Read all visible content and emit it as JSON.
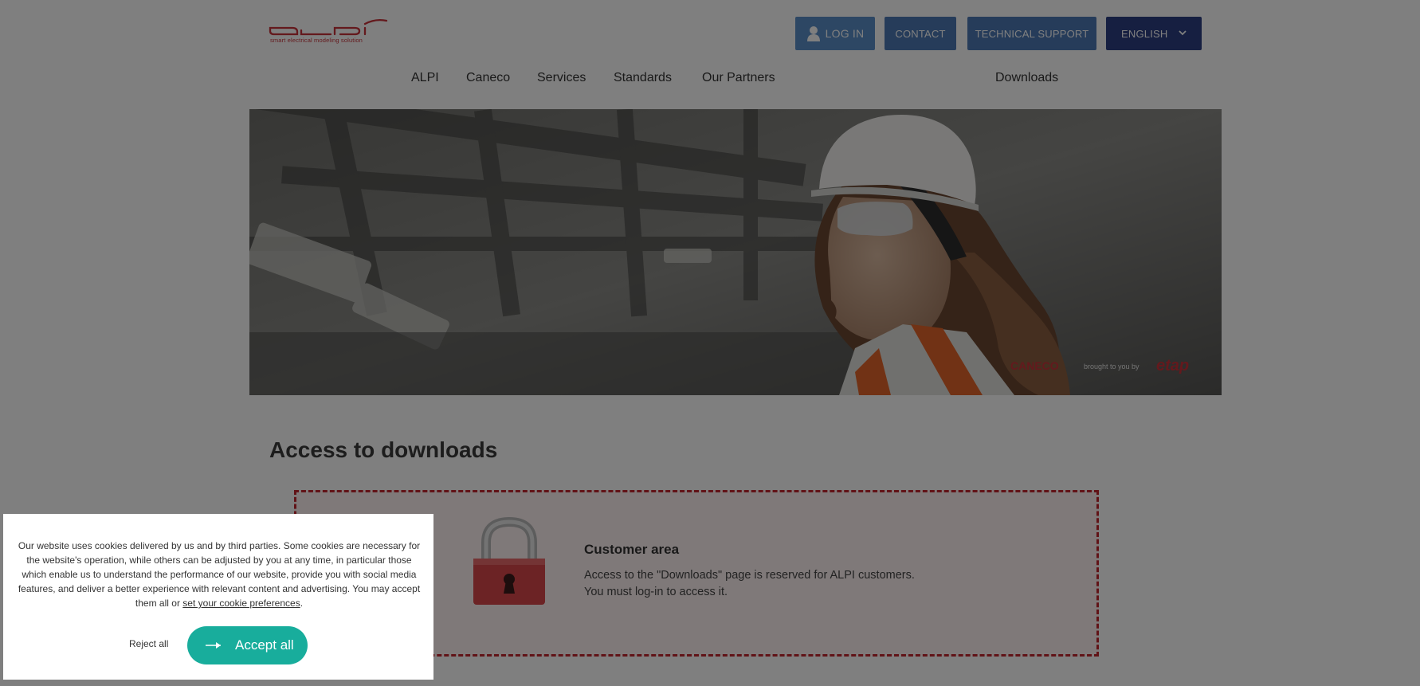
{
  "brand": {
    "logo_text": "ALPI",
    "tagline": "smart electrical modeling solution",
    "brand_color": "#c8333a"
  },
  "header": {
    "login_label": "LOG IN",
    "contact_label": "CONTACT",
    "support_label": "TECHNICAL SUPPORT",
    "language_label": "ENGLISH"
  },
  "nav": {
    "items": [
      "ALPI",
      "Caneco",
      "Services",
      "Standards",
      "Our Partners",
      "Downloads"
    ]
  },
  "hero": {
    "image": "industrial worker wearing white hard hat and safety glasses",
    "caption": "CANECO brought to you by etap"
  },
  "main": {
    "title": "Access to downloads",
    "customer_area": {
      "title": "Customer area",
      "line1": "Access to the \"Downloads\" page is reserved for ALPI customers.",
      "line2": "You must log-in to access it.",
      "icon": "padlock-icon"
    }
  },
  "cookie_banner": {
    "text": "Our website uses cookies delivered by us and by third parties. Some cookies are necessary for the website's operation, while others can be adjusted by you at any time, in particular those which enable us to understand the performance of our website, provide you with social media features, and deliver a better experience with relevant content and advertising. You may accept them all or",
    "link_text": "set your cookie preferences",
    "suffix": ".",
    "reject_label": "Reject all",
    "accept_label": "Accept all",
    "accept_color": "#18ad9c"
  }
}
